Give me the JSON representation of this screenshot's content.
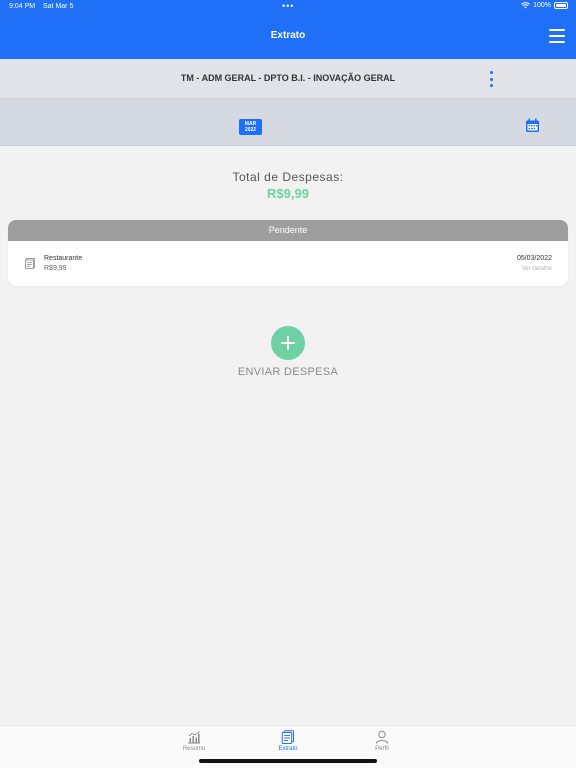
{
  "status": {
    "time": "9:04 PM",
    "date": "Sat Mar 5",
    "battery": "100%"
  },
  "header": {
    "title": "Extrato"
  },
  "company": {
    "name": "TM - ADM GERAL - DPTO B.I. - INOVAÇÃO GERAL"
  },
  "period": {
    "month": "MAR",
    "year": "2022"
  },
  "summary": {
    "label": "Total de Despesas:",
    "value": "R$9,99"
  },
  "pending": {
    "header": "Pendente",
    "items": [
      {
        "name": "Restaurante",
        "amount": "R$9,99",
        "date": "05/03/2022",
        "link": "Ver detalhe"
      }
    ]
  },
  "actions": {
    "send_expense": "ENVIAR DESPESA"
  },
  "tabs": [
    {
      "label": "Resumo",
      "icon": "chart-icon"
    },
    {
      "label": "Extrato",
      "icon": "statement-icon",
      "active": true
    },
    {
      "label": "Perfil",
      "icon": "user-icon"
    }
  ],
  "colors": {
    "primary": "#1f6ff7",
    "accent_green": "#6fd1a3",
    "pending_gray": "#9e9e9e"
  }
}
